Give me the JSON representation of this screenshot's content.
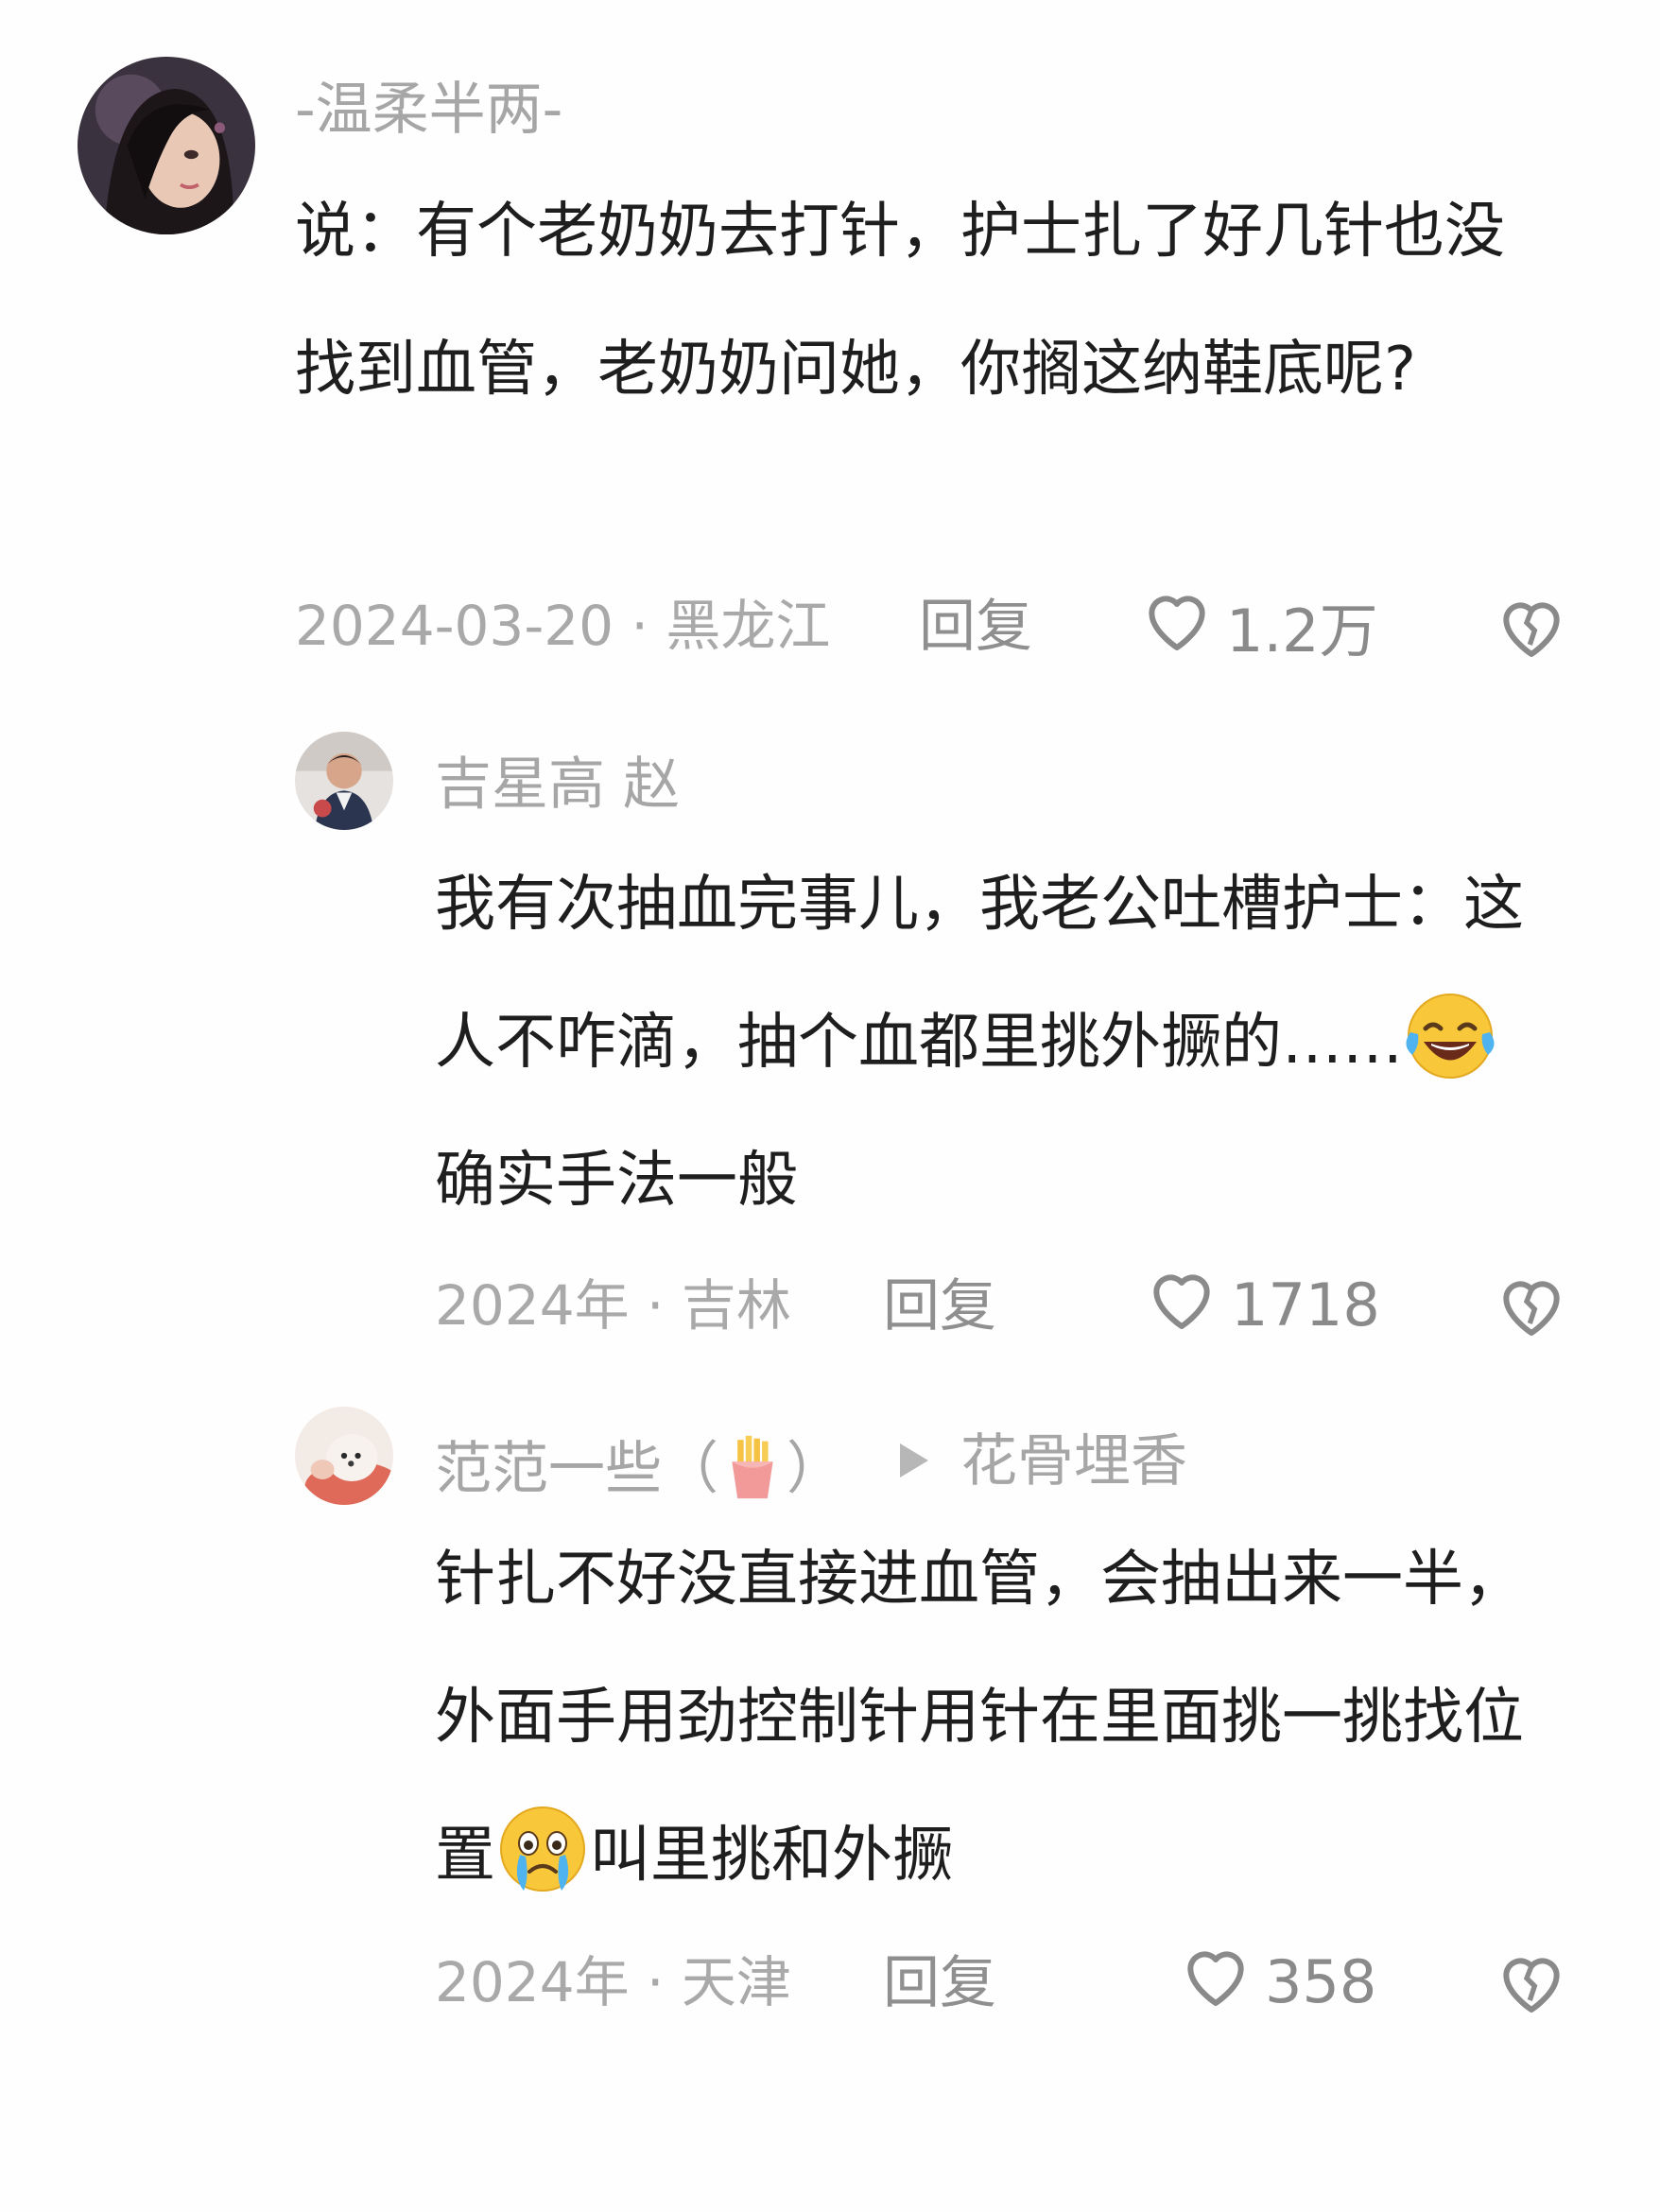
{
  "comments": [
    {
      "username": "-温柔半两-",
      "content": "说：有个老奶奶去打针，护士扎了好几针也没找到血管，老奶奶问她，你搁这纳鞋底呢?",
      "meta": "2024-03-20 · 黑龙江",
      "reply_label": "回复",
      "likes": "1.2万",
      "avatar_icon": "woman-portrait-avatar"
    },
    {
      "username": "吉星高 赵",
      "content_before_emoji": "我有次抽血完事儿，我老公吐槽护士：这人不咋滴，抽个血都里挑外撅的……",
      "emoji": "laughing-tears-emoji",
      "content_after_emoji": "确实手法一般",
      "meta": "2024年 · 吉林",
      "reply_label": "回复",
      "likes": "1718",
      "avatar_icon": "man-photo-avatar"
    },
    {
      "username_prefix": "范范一些（",
      "username_emoji": "fries-emoji",
      "username_suffix": "）",
      "reply_target": "花骨埋香",
      "content_before_emoji": "针扎不好没直接进血管，会抽出来一半，外面手用劲控制针用针在里面挑一挑找位置",
      "emoji": "crying-emoji",
      "content_after_emoji": "叫里挑和外撅",
      "meta": "2024年 · 天津",
      "reply_label": "回复",
      "likes": "358",
      "avatar_icon": "puppy-photo-avatar"
    }
  ],
  "colors": {
    "text": "#1e1e1e",
    "muted": "#a6a6a6",
    "icon": "#8a8a8a"
  }
}
